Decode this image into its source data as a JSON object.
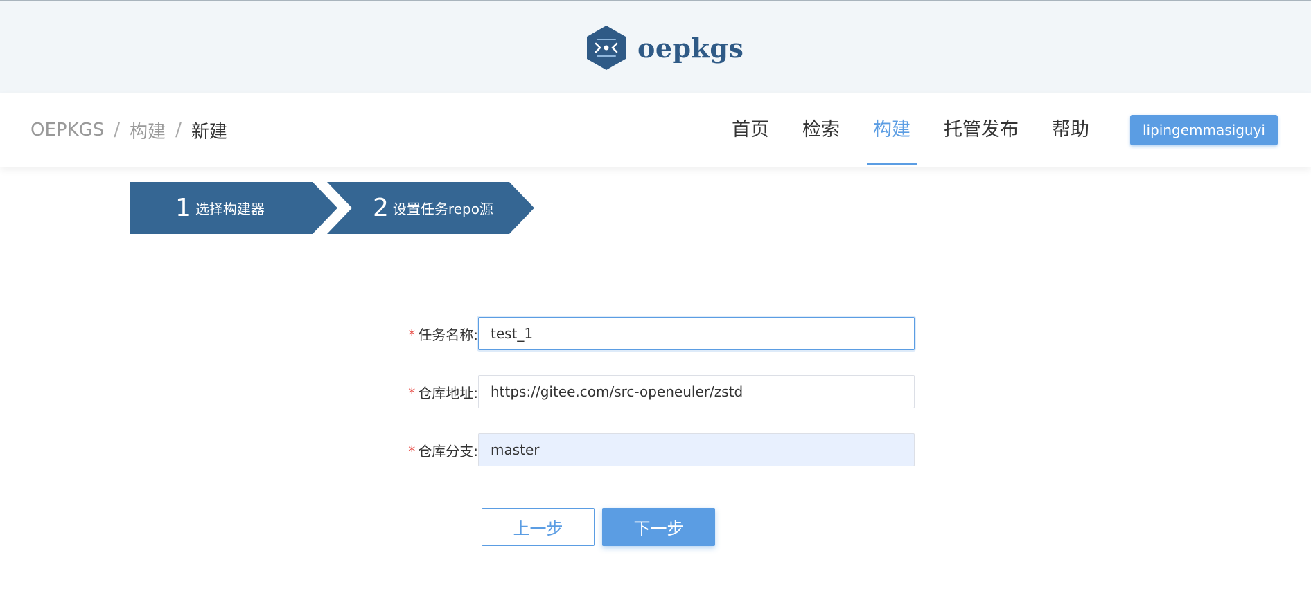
{
  "brand": {
    "name": "oepkgs",
    "logo_icon": "hexagon-logo-icon",
    "color": "#2f5a86"
  },
  "breadcrumb": [
    "OEPKGS",
    "构建",
    "新建"
  ],
  "breadcrumb_separator": "/",
  "nav": {
    "items": [
      "首页",
      "检索",
      "构建",
      "托管发布",
      "帮助"
    ],
    "active": "构建",
    "user": "lipingemmasiguyi",
    "accent": "#5b9de3"
  },
  "steps": [
    {
      "num": "1",
      "label": "选择构建器"
    },
    {
      "num": "2",
      "label": "设置任务repo源"
    }
  ],
  "form": {
    "required_mark": "*",
    "fields": [
      {
        "label": "任务名称:",
        "value": "test_1"
      },
      {
        "label": "仓库地址:",
        "value": "https://gitee.com/src-openeuler/zstd"
      },
      {
        "label": "仓库分支:",
        "value": "master"
      }
    ]
  },
  "buttons": {
    "prev": "上一步",
    "next": "下一步"
  }
}
